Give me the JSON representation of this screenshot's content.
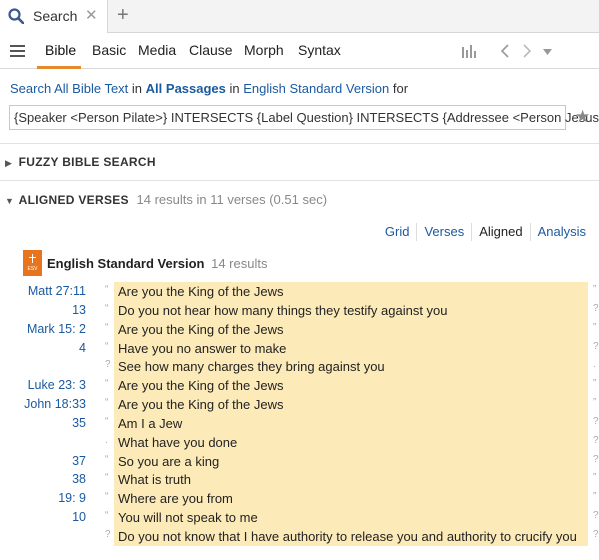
{
  "tab": {
    "title": "Search",
    "close": "✕",
    "add": "+"
  },
  "toolbar": {
    "tabs": [
      "Bible",
      "Basic",
      "Media",
      "Clause",
      "Morph",
      "Syntax"
    ],
    "active_tab": "Bible"
  },
  "search_line": {
    "search": "Search",
    "all_bible_text": "All Bible Text",
    "in1": "in",
    "all_passages": "All Passages",
    "in2": "in",
    "version": "English Standard Version",
    "for": "for"
  },
  "query": "{Speaker <Person Pilate>} INTERSECTS {Label Question} INTERSECTS {Addressee <Person Jesus>}",
  "sections": {
    "fuzzy": {
      "title": "FUZZY BIBLE SEARCH"
    },
    "aligned": {
      "title": "ALIGNED VERSES",
      "stats": "14 results in 11 verses (0.51 sec)"
    }
  },
  "view_tabs": [
    "Grid",
    "Verses",
    "Aligned",
    "Analysis"
  ],
  "active_view": "Aligned",
  "version_header": {
    "icon_label": "ESV",
    "name": "English Standard Version",
    "count": "14 results"
  },
  "colors": {
    "accent": "#e38a2c",
    "link": "#1a5aa0",
    "highlight": "#fcebb8",
    "esv_icon": "#e8741e"
  },
  "results": [
    {
      "ref": "Matt  27:11",
      "mark": "“",
      "text": "Are you the King of the Jews",
      "rmark": "”"
    },
    {
      "ref": "13",
      "mark": "“",
      "text": "Do you not hear how many things they testify against you",
      "rmark": "?"
    },
    {
      "ref": "Mark 15:  2",
      "mark": "“",
      "text": "Are you the King of the Jews",
      "rmark": "”"
    },
    {
      "ref": "4",
      "mark": "“",
      "text": "Have you no answer to make",
      "rmark": "?"
    },
    {
      "ref": "",
      "mark": "?",
      "text": "See how many charges they bring against you",
      "rmark": "."
    },
    {
      "ref": "Luke 23:  3",
      "mark": "“",
      "text": "Are you the King of the Jews",
      "rmark": "”"
    },
    {
      "ref": "John 18:33",
      "mark": "“",
      "text": "Are you the King of the Jews",
      "rmark": "”"
    },
    {
      "ref": "35",
      "mark": "“",
      "text": "Am I a Jew",
      "rmark": "?"
    },
    {
      "ref": "",
      "mark": ".",
      "text": "What have you done",
      "rmark": "?"
    },
    {
      "ref": "37",
      "mark": "“",
      "text": "So you are a king",
      "rmark": "?"
    },
    {
      "ref": "38",
      "mark": "“",
      "text": "What is truth",
      "rmark": "”"
    },
    {
      "ref": "19:  9",
      "mark": "“",
      "text": "Where are you from",
      "rmark": "”"
    },
    {
      "ref": "10",
      "mark": "“",
      "text": "You will not speak to me",
      "rmark": "?"
    },
    {
      "ref": "",
      "mark": "?",
      "text": "Do you not know that I have authority to release you and authority to crucify you",
      "rmark": "?"
    }
  ]
}
